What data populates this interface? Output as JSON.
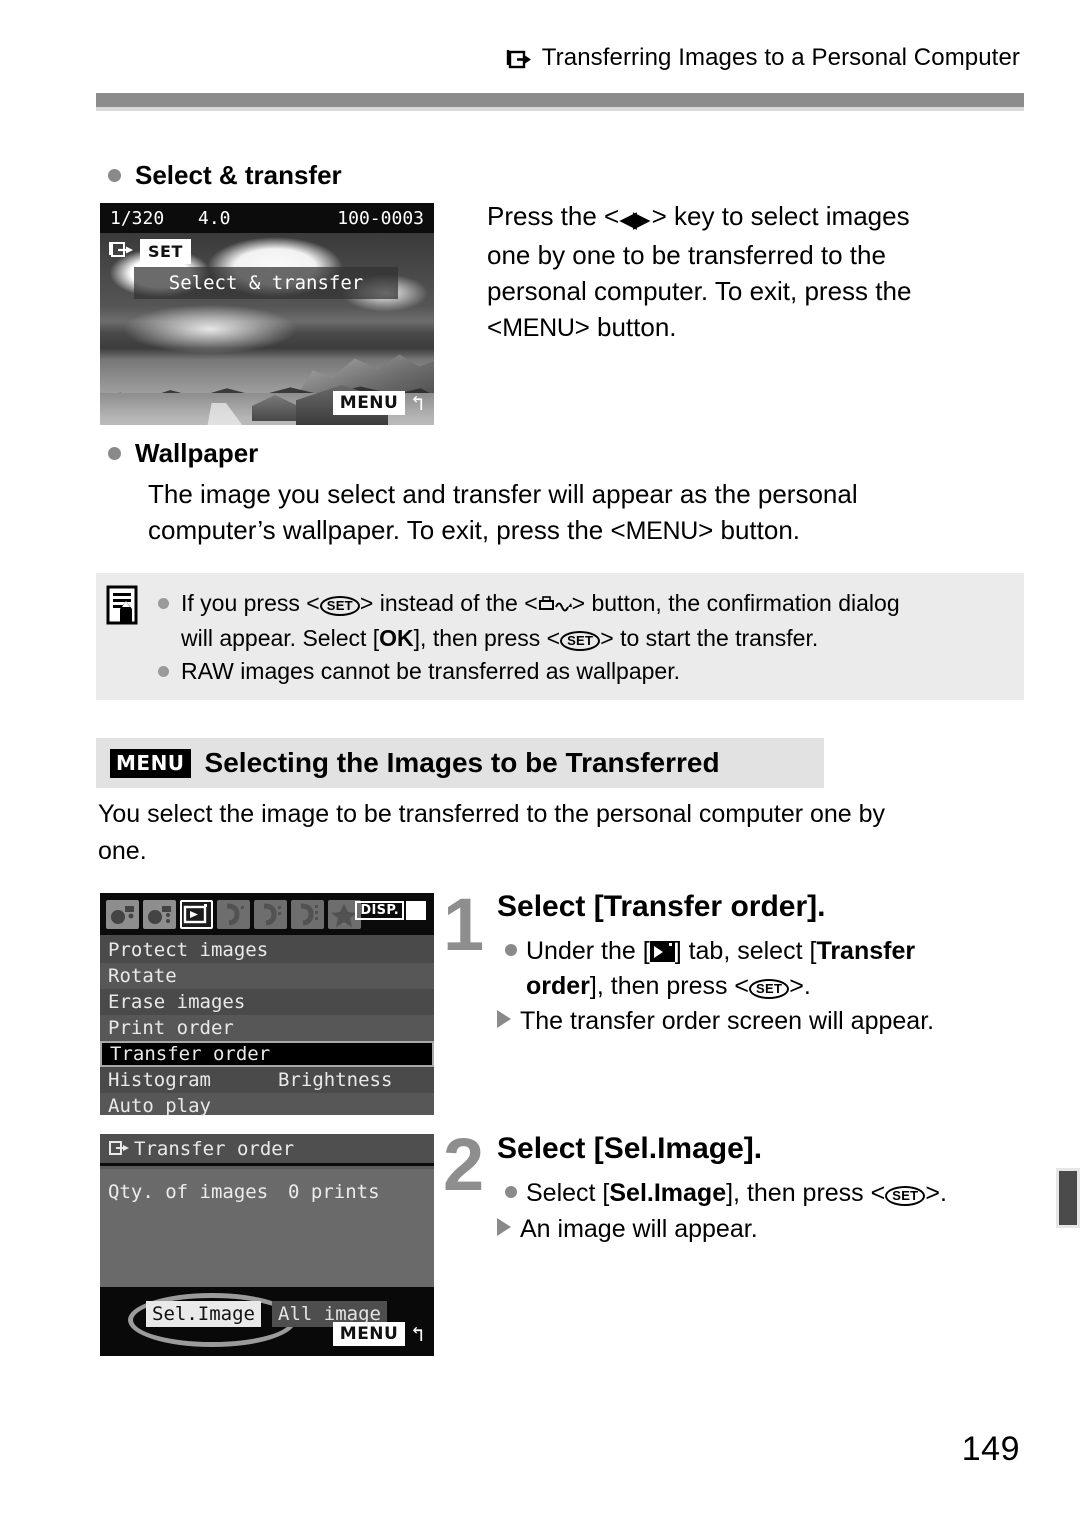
{
  "header": {
    "icon": "transfer-icon",
    "title": "Transferring Images to a Personal Computer"
  },
  "sections": {
    "select_transfer": {
      "heading": "Select & transfer",
      "paragraph_line1": "Press the <",
      "paragraph_arrows": "◀▶",
      "paragraph_line1b": "> key to select images",
      "paragraph_line2": "one by one to be transferred to the",
      "paragraph_line3": "personal computer. To exit, press the",
      "paragraph_line4a": "<",
      "paragraph_menu": "MENU",
      "paragraph_line4b": "> button."
    },
    "wallpaper": {
      "heading": "Wallpaper",
      "line1": "The image you select and transfer will appear as the personal",
      "line2a": "computer’s wallpaper. To exit, press the <",
      "menu_word": "MENU",
      "line2b": "> button."
    }
  },
  "lcd_photo": {
    "shutter_speed": "1/320",
    "aperture": "4.0",
    "file_number": "100-0003",
    "set_badge": "SET",
    "overlay_label": "Select & transfer",
    "menu_badge": "MENU",
    "return_glyph": "↰"
  },
  "note_box": {
    "icon": "note-pencil-icon",
    "items": [
      {
        "parts": [
          "If you press <",
          "SET",
          "> instead of the <",
          "print-share-icon",
          "> button, the confirmation dialog"
        ],
        "line2_a": "will appear. Select [",
        "line2_ok": "OK",
        "line2_b": "], then press <",
        "line2_set": "SET",
        "line2_c": "> to start the transfer."
      },
      {
        "text": "RAW images cannot be transferred as wallpaper."
      }
    ]
  },
  "section_heading": {
    "badge": "MENU",
    "title": "Selecting the Images to be Transferred"
  },
  "intro": {
    "line1": "You select the image to be transferred to the personal computer one by",
    "line2": "one."
  },
  "lcd_menu": {
    "disp_badge": "DISP.",
    "tabs": [
      {
        "name": "shooting-tab-1",
        "selected": false
      },
      {
        "name": "shooting-tab-2",
        "selected": false
      },
      {
        "name": "playback-tab",
        "selected": true
      },
      {
        "name": "setup-tab-1",
        "selected": false
      },
      {
        "name": "setup-tab-2",
        "selected": false
      },
      {
        "name": "setup-tab-3",
        "selected": false
      },
      {
        "name": "my-menu-tab",
        "selected": false
      }
    ],
    "items": [
      {
        "label": "Protect images",
        "value": "",
        "highlighted": false
      },
      {
        "label": "Rotate",
        "value": "",
        "highlighted": false
      },
      {
        "label": "Erase images",
        "value": "",
        "highlighted": false
      },
      {
        "label": "Print order",
        "value": "",
        "highlighted": false
      },
      {
        "label": "Transfer order",
        "value": "",
        "highlighted": true
      },
      {
        "label": "Histogram",
        "value": "Brightness",
        "highlighted": false
      },
      {
        "label": "Auto play",
        "value": "",
        "highlighted": false
      }
    ]
  },
  "lcd_dialog": {
    "title": "Transfer order",
    "qty_label": "Qty. of images",
    "qty_value": "0 prints",
    "button_selected": "Sel.Image",
    "button_other": "All image",
    "menu_badge": "MENU",
    "return_glyph": "↰"
  },
  "steps": [
    {
      "number": "1",
      "title": "Select [Transfer order].",
      "bullet_a": "Under the [",
      "bullet_tab": "playback-tab-glyph",
      "bullet_b": "] tab, select [",
      "bullet_bold": "Transfer",
      "bullet_bold2": "order",
      "bullet_c": "], then press <",
      "bullet_set": "SET",
      "bullet_d": ">.",
      "result": "The transfer order screen will appear."
    },
    {
      "number": "2",
      "title": "Select [Sel.Image].",
      "bullet_a": "Select [",
      "bullet_bold": "Sel.Image",
      "bullet_b": "], then press <",
      "bullet_set": "SET",
      "bullet_c": ">.",
      "result": "An image will appear."
    }
  ],
  "page_number": "149",
  "colors": {
    "rule_gray": "#8c8c8c",
    "note_bg": "#ebebeb",
    "heading_bg": "#e2e2e2",
    "accent_gray": "#8e8e8e"
  }
}
